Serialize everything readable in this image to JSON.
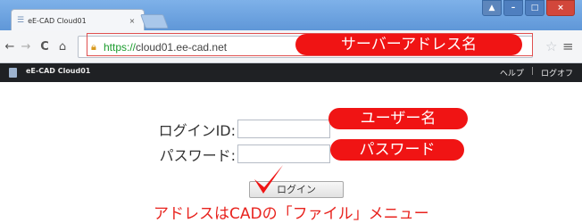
{
  "browser": {
    "tab": {
      "title": "eE-CAD Cloud01",
      "close": "×"
    },
    "window_controls": {
      "user": "▲",
      "minimize": "–",
      "maximize": "□",
      "close": "×"
    },
    "nav": {
      "back": "←",
      "forward": "→",
      "reload": "C",
      "home": "⌂"
    },
    "address": {
      "scheme": "https://",
      "host": "cloud01.ee-cad.net"
    },
    "star": "☆",
    "menu": "≡"
  },
  "app": {
    "title": "eE-CAD Cloud01",
    "links": {
      "help": "ヘルプ",
      "separator": "|",
      "logout": "ログオフ"
    }
  },
  "login": {
    "id_label": "ログインID:",
    "password_label": "パスワード:",
    "id_value": "",
    "password_value": "",
    "button_label": "ログイン"
  },
  "annotations": {
    "server_address": "サーバーアドレス名",
    "username": "ユーザー名",
    "password": "パスワード",
    "caption": "アドレスはCADの「ファイル」メニュー"
  },
  "colors": {
    "annotation_red": "#f01414",
    "caption_red": "#e8231e",
    "appbar": "#1f2124",
    "titlebar": "#6fa4e2"
  }
}
